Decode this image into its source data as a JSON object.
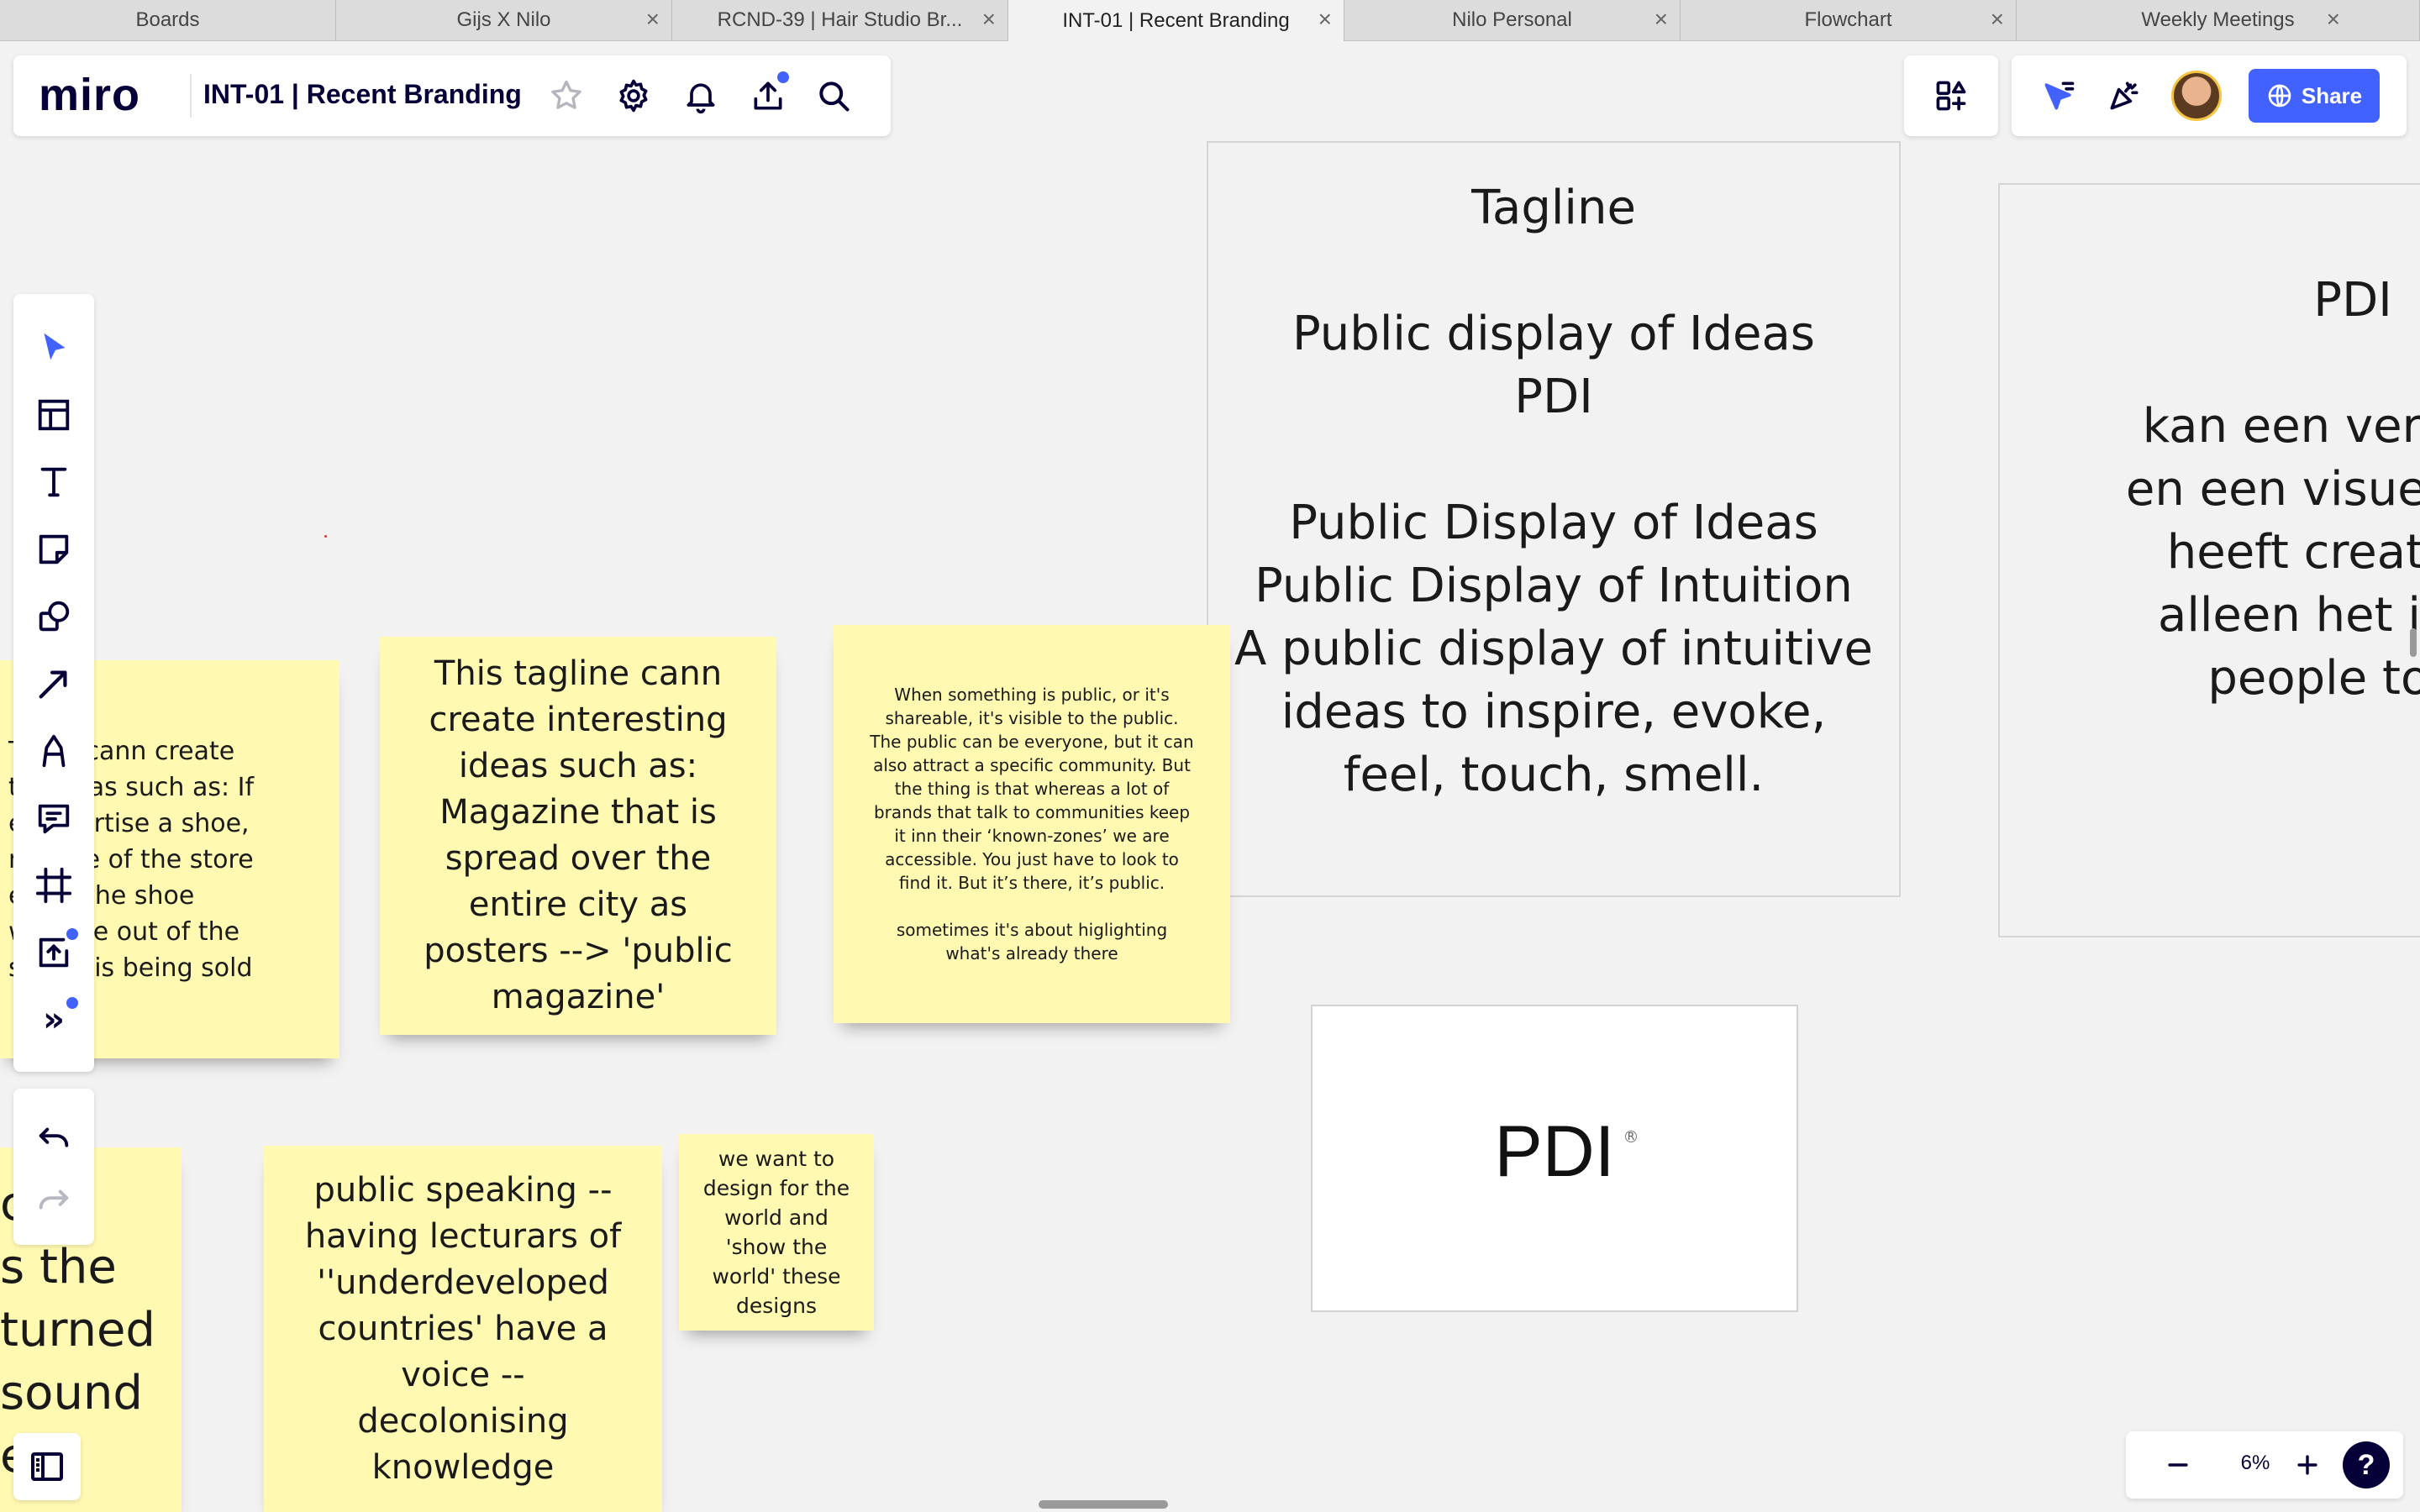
{
  "browser_tabs": [
    {
      "label": "Boards",
      "active": false,
      "closable": false
    },
    {
      "label": "Gijs X Nilo",
      "active": false,
      "closable": true
    },
    {
      "label": "RCND-39 | Hair Studio Br...",
      "active": false,
      "closable": true
    },
    {
      "label": "INT-01 | Recent Branding",
      "active": true,
      "closable": true
    },
    {
      "label": "Nilo Personal",
      "active": false,
      "closable": true
    },
    {
      "label": "Flowchart",
      "active": false,
      "closable": true
    },
    {
      "label": "Weekly Meetings",
      "active": false,
      "closable": true
    }
  ],
  "topbar": {
    "logo": "miro",
    "board_title": "INT-01 | Recent Branding",
    "icons": [
      "star-icon",
      "gear-icon",
      "bell-icon",
      "upload-icon",
      "search-icon"
    ]
  },
  "topbar_right": {
    "share_label": "Share",
    "icons": [
      "apps-icon",
      "cursor-filter-icon",
      "celebrate-icon",
      "avatar"
    ]
  },
  "toolbar": {
    "tools": [
      "select",
      "templates",
      "text",
      "sticky-note",
      "shapes",
      "connection-line",
      "pen",
      "comment",
      "frame",
      "upload",
      "more"
    ],
    "more_label": "»"
  },
  "canvas": {
    "stickies": {
      "s1": "T    line cann create\nt    g ideas such as: If\ne      advertise a shoe,\nn      nside of the store\n       elling the shoe\nw      made out of the\nso    hat is being sold",
      "s2": "This tagline cann create interesting ideas such as: Magazine that is spread over the entire city as posters --> 'public magazine'",
      "s3": "When something is public, or it's shareable, it's visible to the public.\nThe public can be everyone, but it can also attract a specific community. But the thing is that whereas a lot of brands that talk to communities keep it inn their ‘known-zones’ we are accessible. You just have to look to find it. But it’s there, it’s public.\n\nsometimes it's about higlighting what's already there",
      "s4": "c  ds\ns the\nturned\nsound\ne   e",
      "s5": "public speaking -- having lecturars of ''underdeveloped countries' have a voice  -- decolonising knowledge",
      "s6": "we want to design for the world and 'show the world' these designs"
    },
    "frame_tagline": "Tagline\n\nPublic display of Ideas\nPDI\n\nPublic Display of Ideas\nPublic Display of Intuition\nA public display of intuitive ideas to inspire, evoke, feel, touch, smell.",
    "frame_pdi": "PDI\n\nkan een vertaal sl\nen een visueel slag\nheeft creativitei\nalleen het is aan\npeople to se",
    "logo_card": {
      "text": "PDI",
      "mark": "R"
    }
  },
  "zoom": {
    "value": "6%",
    "help_label": "?"
  },
  "colors": {
    "accent": "#4262ff",
    "sticky_yellow": "#fff9b1",
    "text_dark": "#050038"
  }
}
